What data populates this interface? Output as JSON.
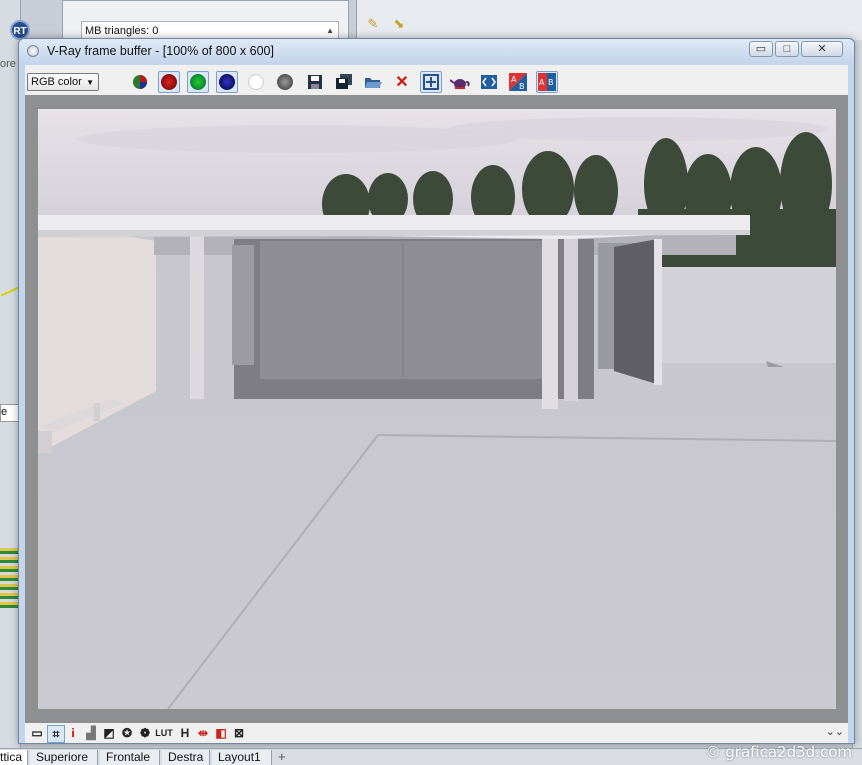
{
  "background_app": {
    "rt_label": "RT",
    "left_fragment": "ore",
    "left_select_value": "e",
    "panel_field": "MB triangles: 0"
  },
  "vfb": {
    "title": "V-Ray frame buffer - [100% of 800 x 600]",
    "window_buttons": {
      "minimize": "▭",
      "maximize": "□",
      "close": "✕"
    },
    "channel_select": "RGB color",
    "toolbar_icons": [
      "rgb-channels-icon",
      "red-channel-icon",
      "green-channel-icon",
      "blue-channel-icon",
      "alpha-channel-icon",
      "mono-icon",
      "save-icon",
      "save-all-icon",
      "load-icon",
      "clear-icon",
      "region-render-icon",
      "render-teapot-icon",
      "history-icon",
      "compare-ab-horizontal-icon",
      "compare-ab-vertical-icon"
    ],
    "status_icons": {
      "info": "i",
      "lut": "LUT",
      "hist": "H"
    }
  },
  "tabs": [
    "ttica",
    "Superiore",
    "Frontale",
    "Destra",
    "Layout1"
  ],
  "tab_add": "+",
  "watermark": "© grafica2d3d.com",
  "colors": {
    "window_frame": "#c2d5ec",
    "toolbar_bg": "#f0f0f0",
    "viewport_bg": "#8e8f91",
    "close_red": "#d2140a"
  }
}
